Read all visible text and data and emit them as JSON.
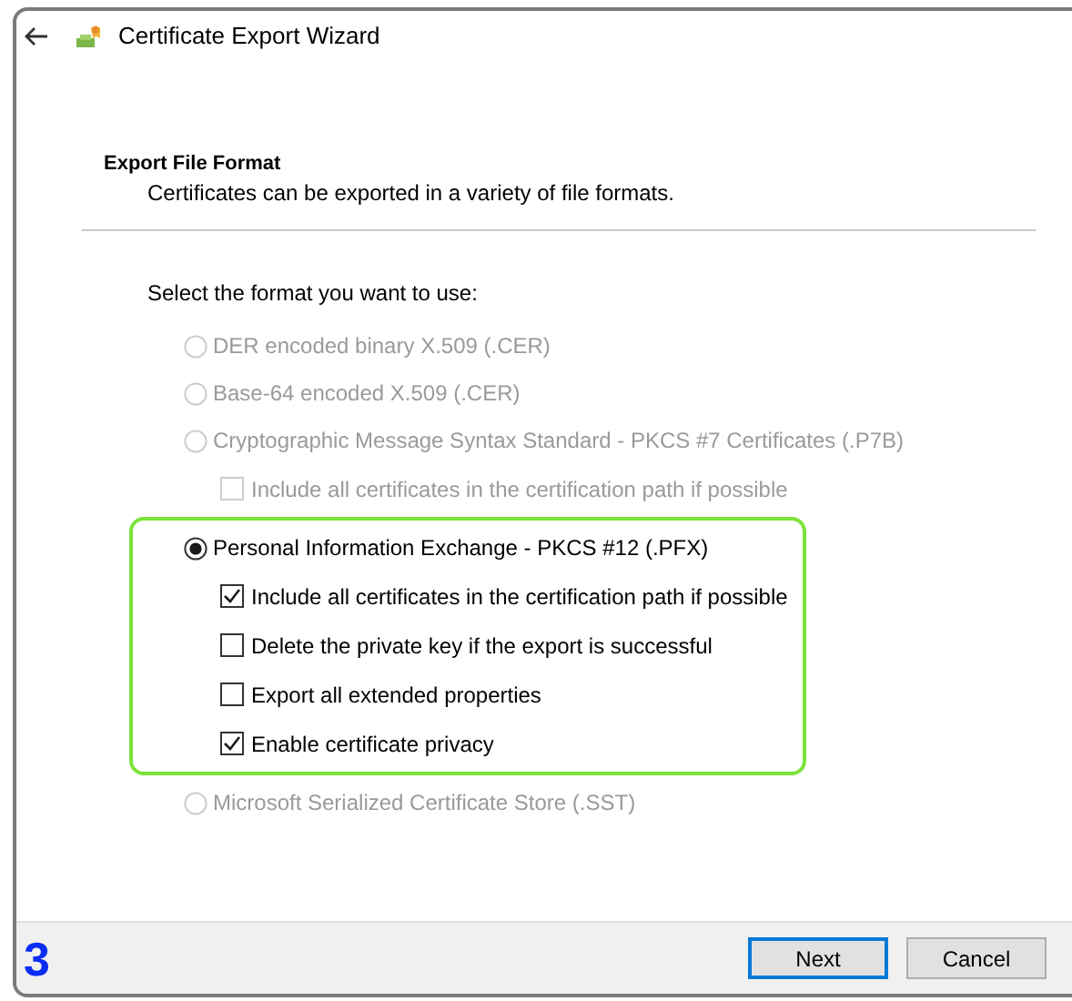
{
  "window": {
    "title": "Certificate Export Wizard"
  },
  "header": {
    "title": "Export File Format",
    "subtitle": "Certificates can be exported in a variety of file formats."
  },
  "prompt": "Select the format you want to use:",
  "options": [
    {
      "label": "DER encoded binary X.509 (.CER)",
      "selected": false,
      "disabled": true,
      "highlighted": false
    },
    {
      "label": "Base-64 encoded X.509 (.CER)",
      "selected": false,
      "disabled": true,
      "highlighted": false
    },
    {
      "label": "Cryptographic Message Syntax Standard - PKCS #7 Certificates (.P7B)",
      "selected": false,
      "disabled": true,
      "highlighted": false,
      "children": [
        {
          "label": "Include all certificates in the certification path if possible",
          "checked": false,
          "disabled": true
        }
      ]
    },
    {
      "label": "Personal Information Exchange - PKCS #12 (.PFX)",
      "selected": true,
      "disabled": false,
      "highlighted": true,
      "children": [
        {
          "label": "Include all certificates in the certification path if possible",
          "checked": true,
          "disabled": false
        },
        {
          "label": "Delete the private key if the export is successful",
          "checked": false,
          "disabled": false
        },
        {
          "label": "Export all extended properties",
          "checked": false,
          "disabled": false
        },
        {
          "label": "Enable certificate privacy",
          "checked": true,
          "disabled": false
        }
      ]
    },
    {
      "label": "Microsoft Serialized Certificate Store (.SST)",
      "selected": false,
      "disabled": true,
      "highlighted": false
    }
  ],
  "step": "3",
  "buttons": [
    {
      "label": "Next",
      "default": true
    },
    {
      "label": "Cancel",
      "default": false
    }
  ]
}
